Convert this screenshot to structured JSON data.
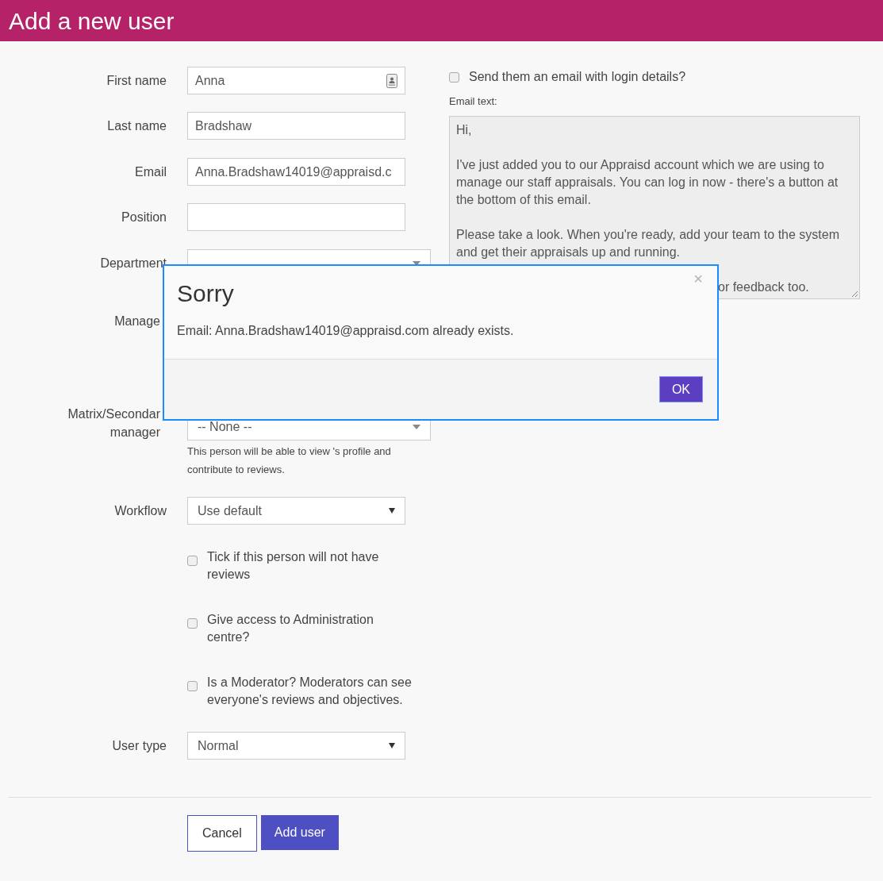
{
  "header": {
    "title": "Add a new user"
  },
  "fields": [
    {
      "kind": "text",
      "label": [
        "First name"
      ],
      "value": "Anna",
      "contact_icon": true
    },
    {
      "kind": "text",
      "label": [
        "Last name"
      ],
      "value": "Bradshaw"
    },
    {
      "kind": "text",
      "label": [
        "Email"
      ],
      "value": "Anna.Bradshaw14019@appraisd.c"
    },
    {
      "kind": "text",
      "label": [
        "Position"
      ]
    },
    {
      "kind": "select",
      "label": [
        "Department"
      ],
      "wide": true
    },
    {
      "kind": "covered",
      "label": [
        "Manage"
      ]
    },
    {
      "kind": "select",
      "label": [
        "Matrix/Secondar",
        "manager"
      ],
      "value": "-- None --",
      "wide": true,
      "help": "This person will be able to view 's profile and contribute to reviews."
    },
    {
      "kind": "select",
      "label": [
        "Workflow"
      ],
      "value": "Use default"
    }
  ],
  "checkboxes": [
    {
      "label": "Tick if this person will not have reviews",
      "checked": false
    },
    {
      "label": "Give access to Administration centre?",
      "checked": false
    },
    {
      "label": "Is a Moderator? Moderators can see everyone's reviews and objectives.",
      "checked": false
    }
  ],
  "user_type": {
    "label": "User type",
    "value": "Normal"
  },
  "buttons": [
    {
      "label": "Cancel",
      "kind": "secondary"
    },
    {
      "label": "Add user",
      "kind": "primary"
    }
  ],
  "send_email": {
    "label": "Send them an email with login details?",
    "checked": false
  },
  "email_text": {
    "label": "Email text:",
    "paragraphs": [
      "Hi,",
      "I've just added you to our Appraisd account which we are using to manage our staff appraisals. You can log in now - there's a button at the bottom of this email.",
      "Please take a look. When you're ready, add your team to the system and get their appraisals up and running."
    ],
    "fragment": "or feedback too."
  },
  "modal": {
    "title": "Sorry",
    "close": "×",
    "message": "Email: Anna.Bradshaw14019@appraisd.com already exists.",
    "ok": "OK"
  }
}
